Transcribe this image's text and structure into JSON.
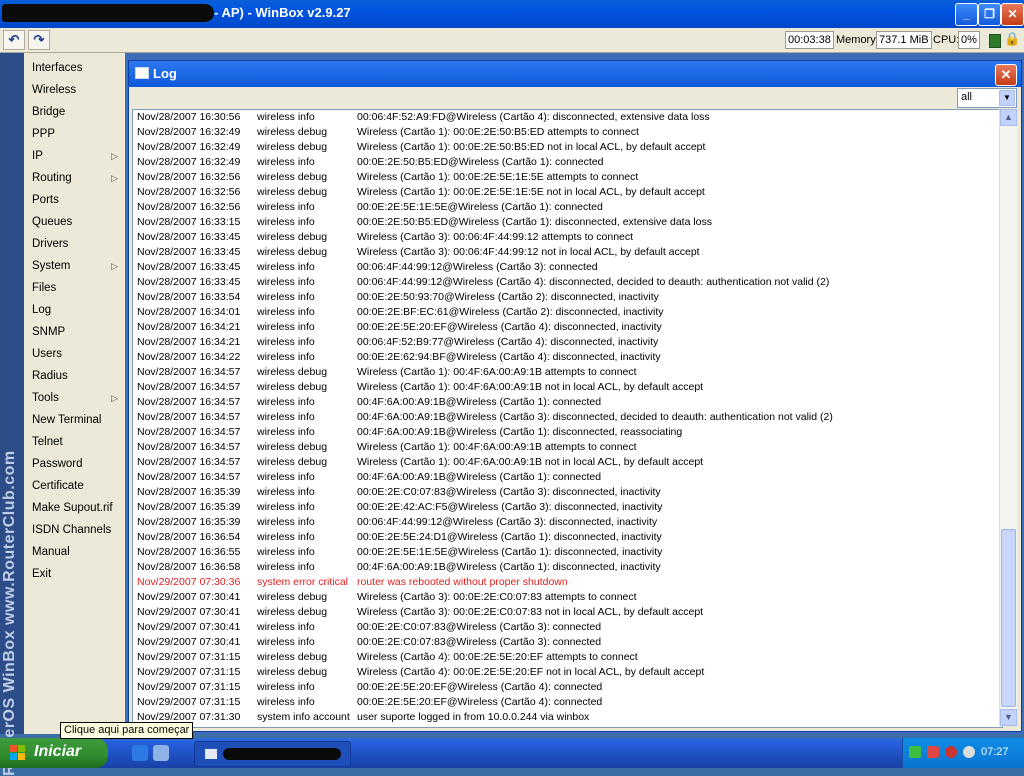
{
  "window": {
    "title": "- AP) - WinBox v2.9.27",
    "minimize_label": "_",
    "maximize_label": "❐",
    "close_label": "✕"
  },
  "toolbar": {
    "undo_icon": "↶",
    "redo_icon": "↷",
    "uptime": "00:03:38",
    "memory_label": "Memory:",
    "memory_value": "737.1 MiB",
    "cpu_label": "CPU:",
    "cpu_value": "0%",
    "lock_icon": "🔒"
  },
  "brand": {
    "vertical_text": "RouterOS WinBox   www.RouterClub.com"
  },
  "sidebar": {
    "items": [
      {
        "label": "Interfaces",
        "submenu": false
      },
      {
        "label": "Wireless",
        "submenu": false
      },
      {
        "label": "Bridge",
        "submenu": false
      },
      {
        "label": "PPP",
        "submenu": false
      },
      {
        "label": "IP",
        "submenu": true
      },
      {
        "label": "Routing",
        "submenu": true
      },
      {
        "label": "Ports",
        "submenu": false
      },
      {
        "label": "Queues",
        "submenu": false
      },
      {
        "label": "Drivers",
        "submenu": false
      },
      {
        "label": "System",
        "submenu": true
      },
      {
        "label": "Files",
        "submenu": false
      },
      {
        "label": "Log",
        "submenu": false
      },
      {
        "label": "SNMP",
        "submenu": false
      },
      {
        "label": "Users",
        "submenu": false
      },
      {
        "label": "Radius",
        "submenu": false
      },
      {
        "label": "Tools",
        "submenu": true
      },
      {
        "label": "New Terminal",
        "submenu": false
      },
      {
        "label": "Telnet",
        "submenu": false
      },
      {
        "label": "Password",
        "submenu": false
      },
      {
        "label": "Certificate",
        "submenu": false
      },
      {
        "label": "Make Supout.rif",
        "submenu": false
      },
      {
        "label": "ISDN Channels",
        "submenu": false
      },
      {
        "label": "Manual",
        "submenu": false
      },
      {
        "label": "Exit",
        "submenu": false
      }
    ],
    "submenu_arrow": "▷"
  },
  "log": {
    "title": "Log",
    "close_label": "✕",
    "filter_value": "all",
    "filter_arrow": "▼",
    "scroll_up": "▲",
    "scroll_down": "▼",
    "rows": [
      {
        "time": "Nov/28/2007 16:30:56",
        "topic": "wireless info",
        "message": "00:06:4F:52:A9:FD@Wireless (Cartão 4): disconnected, extensive data loss",
        "error": false
      },
      {
        "time": "Nov/28/2007 16:32:49",
        "topic": "wireless debug",
        "message": "Wireless (Cartão 1): 00:0E:2E:50:B5:ED attempts to connect",
        "error": false
      },
      {
        "time": "Nov/28/2007 16:32:49",
        "topic": "wireless debug",
        "message": "Wireless (Cartão 1): 00:0E:2E:50:B5:ED not in local ACL, by default accept",
        "error": false
      },
      {
        "time": "Nov/28/2007 16:32:49",
        "topic": "wireless info",
        "message": "00:0E:2E:50:B5:ED@Wireless (Cartão 1): connected",
        "error": false
      },
      {
        "time": "Nov/28/2007 16:32:56",
        "topic": "wireless debug",
        "message": "Wireless (Cartão 1): 00:0E:2E:5E:1E:5E attempts to connect",
        "error": false
      },
      {
        "time": "Nov/28/2007 16:32:56",
        "topic": "wireless debug",
        "message": "Wireless (Cartão 1): 00:0E:2E:5E:1E:5E not in local ACL, by default accept",
        "error": false
      },
      {
        "time": "Nov/28/2007 16:32:56",
        "topic": "wireless info",
        "message": "00:0E:2E:5E:1E:5E@Wireless (Cartão 1): connected",
        "error": false
      },
      {
        "time": "Nov/28/2007 16:33:15",
        "topic": "wireless info",
        "message": "00:0E:2E:50:B5:ED@Wireless (Cartão 1): disconnected, extensive data loss",
        "error": false
      },
      {
        "time": "Nov/28/2007 16:33:45",
        "topic": "wireless debug",
        "message": "Wireless (Cartão 3): 00:06:4F:44:99:12 attempts to connect",
        "error": false
      },
      {
        "time": "Nov/28/2007 16:33:45",
        "topic": "wireless debug",
        "message": "Wireless (Cartão 3): 00:06:4F:44:99:12 not in local ACL, by default accept",
        "error": false
      },
      {
        "time": "Nov/28/2007 16:33:45",
        "topic": "wireless info",
        "message": "00:06:4F:44:99:12@Wireless (Cartão 3): connected",
        "error": false
      },
      {
        "time": "Nov/28/2007 16:33:45",
        "topic": "wireless info",
        "message": "00:06:4F:44:99:12@Wireless (Cartão 4): disconnected, decided to deauth: authentication not valid (2)",
        "error": false
      },
      {
        "time": "Nov/28/2007 16:33:54",
        "topic": "wireless info",
        "message": "00:0E:2E:50:93:70@Wireless (Cartão 2): disconnected, inactivity",
        "error": false
      },
      {
        "time": "Nov/28/2007 16:34:01",
        "topic": "wireless info",
        "message": "00:0E:2E:BF:EC:61@Wireless (Cartão 2): disconnected, inactivity",
        "error": false
      },
      {
        "time": "Nov/28/2007 16:34:21",
        "topic": "wireless info",
        "message": "00:0E:2E:5E:20:EF@Wireless (Cartão 4): disconnected, inactivity",
        "error": false
      },
      {
        "time": "Nov/28/2007 16:34:21",
        "topic": "wireless info",
        "message": "00:06:4F:52:B9:77@Wireless (Cartão 4): disconnected, inactivity",
        "error": false
      },
      {
        "time": "Nov/28/2007 16:34:22",
        "topic": "wireless info",
        "message": "00:0E:2E:62:94:BF@Wireless (Cartão 4): disconnected, inactivity",
        "error": false
      },
      {
        "time": "Nov/28/2007 16:34:57",
        "topic": "wireless debug",
        "message": "Wireless (Cartão 1): 00:4F:6A:00:A9:1B attempts to connect",
        "error": false
      },
      {
        "time": "Nov/28/2007 16:34:57",
        "topic": "wireless debug",
        "message": "Wireless (Cartão 1): 00:4F:6A:00:A9:1B not in local ACL, by default accept",
        "error": false
      },
      {
        "time": "Nov/28/2007 16:34:57",
        "topic": "wireless info",
        "message": "00:4F:6A:00:A9:1B@Wireless (Cartão 1): connected",
        "error": false
      },
      {
        "time": "Nov/28/2007 16:34:57",
        "topic": "wireless info",
        "message": "00:4F:6A:00:A9:1B@Wireless (Cartão 3): disconnected, decided to deauth: authentication not valid (2)",
        "error": false
      },
      {
        "time": "Nov/28/2007 16:34:57",
        "topic": "wireless info",
        "message": "00:4F:6A:00:A9:1B@Wireless (Cartão 1): disconnected, reassociating",
        "error": false
      },
      {
        "time": "Nov/28/2007 16:34:57",
        "topic": "wireless debug",
        "message": "Wireless (Cartão 1): 00:4F:6A:00:A9:1B attempts to connect",
        "error": false
      },
      {
        "time": "Nov/28/2007 16:34:57",
        "topic": "wireless debug",
        "message": "Wireless (Cartão 1): 00:4F:6A:00:A9:1B not in local ACL, by default accept",
        "error": false
      },
      {
        "time": "Nov/28/2007 16:34:57",
        "topic": "wireless info",
        "message": "00:4F:6A:00:A9:1B@Wireless (Cartão 1): connected",
        "error": false
      },
      {
        "time": "Nov/28/2007 16:35:39",
        "topic": "wireless info",
        "message": "00:0E:2E:C0:07:83@Wireless (Cartão 3): disconnected, inactivity",
        "error": false
      },
      {
        "time": "Nov/28/2007 16:35:39",
        "topic": "wireless info",
        "message": "00:0E:2E:42:AC:F5@Wireless (Cartão 3): disconnected, inactivity",
        "error": false
      },
      {
        "time": "Nov/28/2007 16:35:39",
        "topic": "wireless info",
        "message": "00:06:4F:44:99:12@Wireless (Cartão 3): disconnected, inactivity",
        "error": false
      },
      {
        "time": "Nov/28/2007 16:36:54",
        "topic": "wireless info",
        "message": "00:0E:2E:5E:24:D1@Wireless (Cartão 1): disconnected, inactivity",
        "error": false
      },
      {
        "time": "Nov/28/2007 16:36:55",
        "topic": "wireless info",
        "message": "00:0E:2E:5E:1E:5E@Wireless (Cartão 1): disconnected, inactivity",
        "error": false
      },
      {
        "time": "Nov/28/2007 16:36:58",
        "topic": "wireless info",
        "message": "00:4F:6A:00:A9:1B@Wireless (Cartão 1): disconnected, inactivity",
        "error": false
      },
      {
        "time": "Nov/29/2007 07:30:36",
        "topic": "system error critical",
        "message": "router was rebooted without proper shutdown",
        "error": true
      },
      {
        "time": "Nov/29/2007 07:30:41",
        "topic": "wireless debug",
        "message": "Wireless (Cartão 3): 00:0E:2E:C0:07:83 attempts to connect",
        "error": false
      },
      {
        "time": "Nov/29/2007 07:30:41",
        "topic": "wireless debug",
        "message": "Wireless (Cartão 3): 00:0E:2E:C0:07:83 not in local ACL, by default accept",
        "error": false
      },
      {
        "time": "Nov/29/2007 07:30:41",
        "topic": "wireless info",
        "message": "00:0E:2E:C0:07:83@Wireless (Cartão 3): connected",
        "error": false
      },
      {
        "time": "Nov/29/2007 07:30:41",
        "topic": "wireless info",
        "message": "00:0E:2E:C0:07:83@Wireless (Cartão 3): connected",
        "error": false
      },
      {
        "time": "Nov/29/2007 07:31:15",
        "topic": "wireless debug",
        "message": "Wireless (Cartão 4): 00:0E:2E:5E:20:EF attempts to connect",
        "error": false
      },
      {
        "time": "Nov/29/2007 07:31:15",
        "topic": "wireless debug",
        "message": "Wireless (Cartão 4): 00:0E:2E:5E:20:EF not in local ACL, by default accept",
        "error": false
      },
      {
        "time": "Nov/29/2007 07:31:15",
        "topic": "wireless info",
        "message": "00:0E:2E:5E:20:EF@Wireless (Cartão 4): connected",
        "error": false
      },
      {
        "time": "Nov/29/2007 07:31:15",
        "topic": "wireless info",
        "message": "00:0E:2E:5E:20:EF@Wireless (Cartão 4): connected",
        "error": false
      },
      {
        "time": "Nov/29/2007 07:31:30",
        "topic": "system info account",
        "message": "user suporte logged in from 10.0.0.244 via winbox",
        "error": false
      }
    ]
  },
  "tooltip": {
    "text": "Clique aqui para começar"
  },
  "taskbar": {
    "start_label": "Iniciar",
    "clock": "07:27"
  },
  "colors": {
    "error_text": "#e02020",
    "desktop": "#3c6db6"
  }
}
